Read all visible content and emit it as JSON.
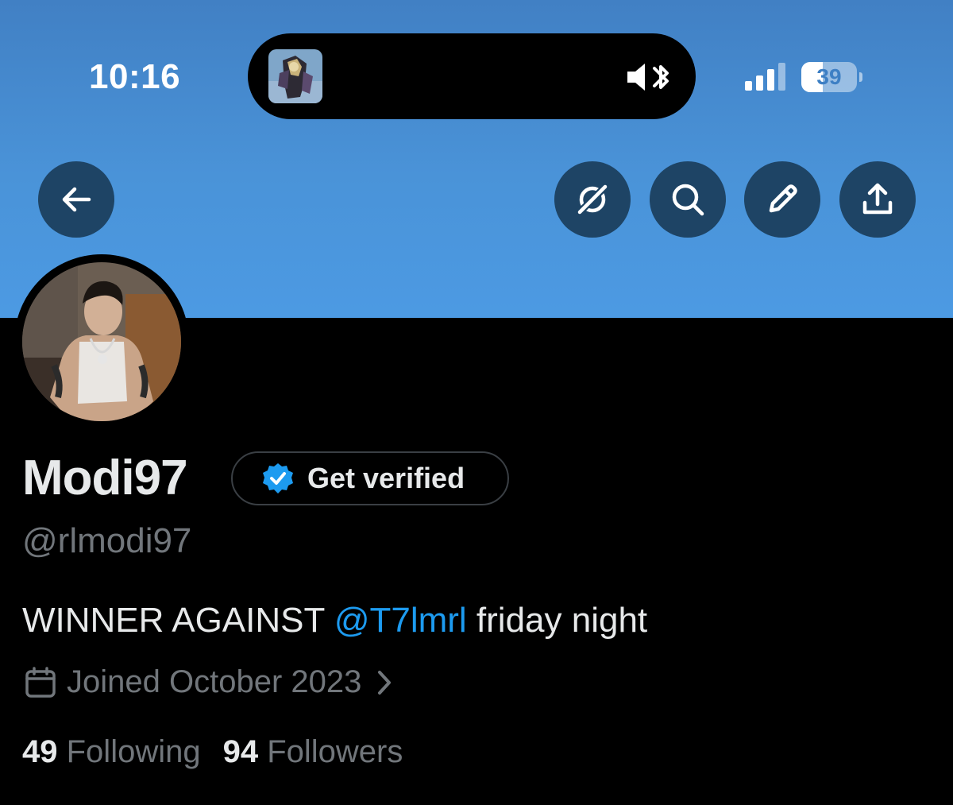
{
  "status_bar": {
    "time": "10:16",
    "battery_level": "39",
    "battery_fraction": 0.39
  },
  "header": {
    "back_icon": "arrow-left-icon",
    "actions": [
      "grok-icon",
      "search-icon",
      "edit-icon",
      "share-icon"
    ]
  },
  "profile": {
    "display_name": "Modi97",
    "verify_label": "Get verified",
    "handle": "@rlmodi97",
    "bio_text": "WINNER AGAINST ",
    "bio_mention": "@T7lmrl",
    "bio_suffix": " friday night",
    "joined": "Joined October 2023",
    "following_count": "49",
    "following_label": "Following",
    "followers_count": "94",
    "followers_label": "Followers"
  },
  "colors": {
    "accent": "#1d9bf0",
    "banner_top": "#4180c4",
    "banner_bottom": "#4c9ae3",
    "button_bg": "#1e4465",
    "text_primary": "#e7e9ea",
    "text_secondary": "#71767b"
  }
}
